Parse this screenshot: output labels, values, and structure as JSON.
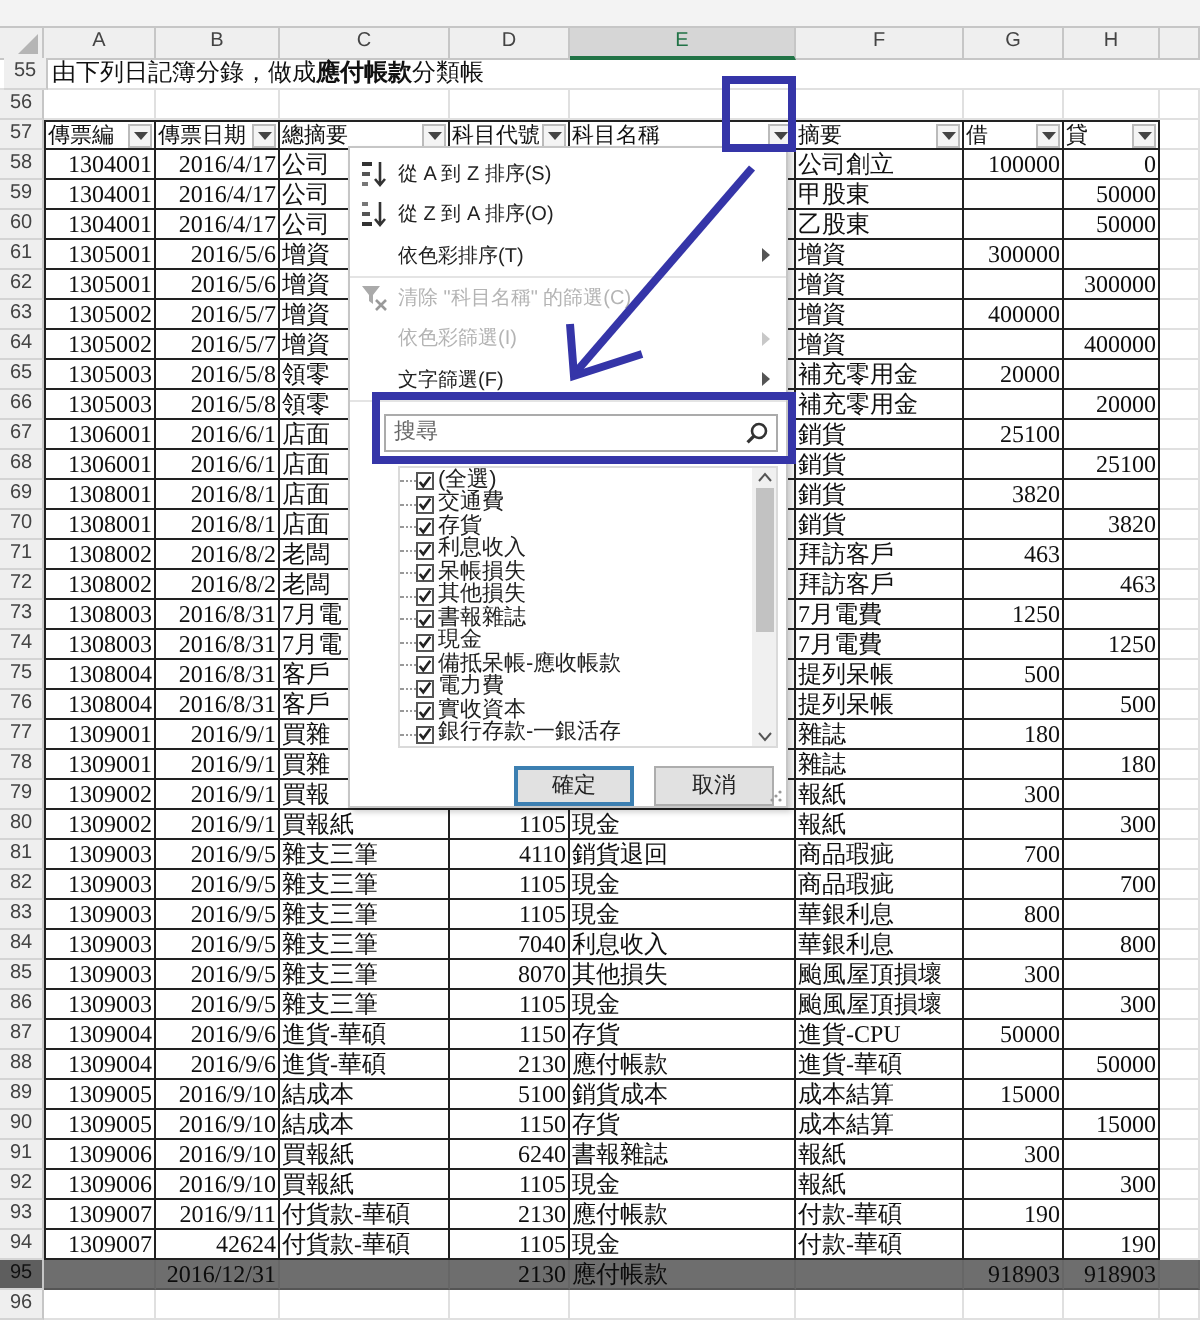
{
  "column_headers": [
    {
      "label": "A",
      "selected": false
    },
    {
      "label": "B",
      "selected": false
    },
    {
      "label": "C",
      "selected": false
    },
    {
      "label": "D",
      "selected": false
    },
    {
      "label": "E",
      "selected": true
    },
    {
      "label": "F",
      "selected": false
    },
    {
      "label": "G",
      "selected": false
    },
    {
      "label": "H",
      "selected": false
    }
  ],
  "rows": [
    {
      "number": "55",
      "kind": "title",
      "text": "由下列日記簿分錄，做成**應付帳款**分類帳"
    },
    {
      "number": "56",
      "kind": "blank"
    },
    {
      "number": "57",
      "kind": "header",
      "cells": [
        "傳票編",
        "傳票日期",
        "總摘要",
        "科目代號",
        "科目名稱",
        "摘要",
        "借",
        "貸"
      ]
    },
    {
      "number": "58",
      "kind": "data",
      "cells": [
        "1304001",
        "2016/4/17",
        "公司",
        null,
        null,
        "公司創立",
        "100000",
        "0"
      ]
    },
    {
      "number": "59",
      "kind": "data",
      "cells": [
        "1304001",
        "2016/4/17",
        "公司",
        null,
        null,
        "甲股東",
        null,
        "50000"
      ]
    },
    {
      "number": "60",
      "kind": "data",
      "cells": [
        "1304001",
        "2016/4/17",
        "公司",
        null,
        null,
        "乙股東",
        null,
        "50000"
      ]
    },
    {
      "number": "61",
      "kind": "data",
      "cells": [
        "1305001",
        "2016/5/6",
        "增資",
        null,
        null,
        "增資",
        "300000",
        null
      ]
    },
    {
      "number": "62",
      "kind": "data",
      "cells": [
        "1305001",
        "2016/5/6",
        "增資",
        null,
        null,
        "增資",
        null,
        "300000"
      ]
    },
    {
      "number": "63",
      "kind": "data",
      "cells": [
        "1305002",
        "2016/5/7",
        "增資",
        null,
        null,
        "增資",
        "400000",
        null
      ]
    },
    {
      "number": "64",
      "kind": "data",
      "cells": [
        "1305002",
        "2016/5/7",
        "增資",
        null,
        null,
        "增資",
        null,
        "400000"
      ]
    },
    {
      "number": "65",
      "kind": "data",
      "cells": [
        "1305003",
        "2016/5/8",
        "領零",
        null,
        null,
        "補充零用金",
        "20000",
        null
      ]
    },
    {
      "number": "66",
      "kind": "data",
      "cells": [
        "1305003",
        "2016/5/8",
        "領零",
        null,
        null,
        "補充零用金",
        null,
        "20000"
      ]
    },
    {
      "number": "67",
      "kind": "data",
      "cells": [
        "1306001",
        "2016/6/1",
        "店面",
        null,
        null,
        "銷貨",
        "25100",
        null
      ]
    },
    {
      "number": "68",
      "kind": "data",
      "cells": [
        "1306001",
        "2016/6/1",
        "店面",
        null,
        null,
        "銷貨",
        null,
        "25100"
      ]
    },
    {
      "number": "69",
      "kind": "data",
      "cells": [
        "1308001",
        "2016/8/1",
        "店面",
        null,
        null,
        "銷貨",
        "3820",
        null
      ]
    },
    {
      "number": "70",
      "kind": "data",
      "cells": [
        "1308001",
        "2016/8/1",
        "店面",
        null,
        null,
        "銷貨",
        null,
        "3820"
      ]
    },
    {
      "number": "71",
      "kind": "data",
      "cells": [
        "1308002",
        "2016/8/2",
        "老闆",
        null,
        null,
        "拜訪客戶",
        "463",
        null
      ]
    },
    {
      "number": "72",
      "kind": "data",
      "cells": [
        "1308002",
        "2016/8/2",
        "老闆",
        null,
        null,
        "拜訪客戶",
        null,
        "463"
      ]
    },
    {
      "number": "73",
      "kind": "data",
      "cells": [
        "1308003",
        "2016/8/31",
        "7月電",
        null,
        null,
        "7月電費",
        "1250",
        null
      ]
    },
    {
      "number": "74",
      "kind": "data",
      "cells": [
        "1308003",
        "2016/8/31",
        "7月電",
        null,
        null,
        "7月電費",
        null,
        "1250"
      ]
    },
    {
      "number": "75",
      "kind": "data",
      "cells": [
        "1308004",
        "2016/8/31",
        "客戶",
        null,
        null,
        "提列呆帳",
        "500",
        null
      ]
    },
    {
      "number": "76",
      "kind": "data",
      "cells": [
        "1308004",
        "2016/8/31",
        "客戶",
        null,
        null,
        "提列呆帳",
        null,
        "500"
      ]
    },
    {
      "number": "77",
      "kind": "data",
      "cells": [
        "1309001",
        "2016/9/1",
        "買雜",
        null,
        null,
        "雜誌",
        "180",
        null
      ]
    },
    {
      "number": "78",
      "kind": "data",
      "cells": [
        "1309001",
        "2016/9/1",
        "買雜",
        null,
        null,
        "雜誌",
        null,
        "180"
      ]
    },
    {
      "number": "79",
      "kind": "data",
      "cells": [
        "1309002",
        "2016/9/1",
        "買報",
        null,
        null,
        "報紙",
        "300",
        null
      ]
    },
    {
      "number": "80",
      "kind": "data",
      "cells": [
        "1309002",
        "2016/9/1",
        "買報紙",
        "1105",
        "現金",
        "報紙",
        null,
        "300"
      ]
    },
    {
      "number": "81",
      "kind": "data",
      "cells": [
        "1309003",
        "2016/9/5",
        "雜支三筆",
        "4110",
        "銷貨退回",
        "商品瑕疵",
        "700",
        null
      ]
    },
    {
      "number": "82",
      "kind": "data",
      "cells": [
        "1309003",
        "2016/9/5",
        "雜支三筆",
        "1105",
        "現金",
        "商品瑕疵",
        null,
        "700"
      ]
    },
    {
      "number": "83",
      "kind": "data",
      "cells": [
        "1309003",
        "2016/9/5",
        "雜支三筆",
        "1105",
        "現金",
        "華銀利息",
        "800",
        null
      ]
    },
    {
      "number": "84",
      "kind": "data",
      "cells": [
        "1309003",
        "2016/9/5",
        "雜支三筆",
        "7040",
        "利息收入",
        "華銀利息",
        null,
        "800"
      ]
    },
    {
      "number": "85",
      "kind": "data",
      "cells": [
        "1309003",
        "2016/9/5",
        "雜支三筆",
        "8070",
        "其他損失",
        "颱風屋頂損壞",
        "300",
        null
      ]
    },
    {
      "number": "86",
      "kind": "data",
      "cells": [
        "1309003",
        "2016/9/5",
        "雜支三筆",
        "1105",
        "現金",
        "颱風屋頂損壞",
        null,
        "300"
      ]
    },
    {
      "number": "87",
      "kind": "data",
      "cells": [
        "1309004",
        "2016/9/6",
        "進貨-華碩",
        "1150",
        "存貨",
        "進貨-CPU",
        "50000",
        null
      ]
    },
    {
      "number": "88",
      "kind": "data",
      "cells": [
        "1309004",
        "2016/9/6",
        "進貨-華碩",
        "2130",
        "應付帳款",
        "進貨-華碩",
        null,
        "50000"
      ]
    },
    {
      "number": "89",
      "kind": "data",
      "cells": [
        "1309005",
        "2016/9/10",
        "結成本",
        "5100",
        "銷貨成本",
        "成本結算",
        "15000",
        null
      ]
    },
    {
      "number": "90",
      "kind": "data",
      "cells": [
        "1309005",
        "2016/9/10",
        "結成本",
        "1150",
        "存貨",
        "成本結算",
        null,
        "15000"
      ]
    },
    {
      "number": "91",
      "kind": "data",
      "cells": [
        "1309006",
        "2016/9/10",
        "買報紙",
        "6240",
        "書報雜誌",
        "報紙",
        "300",
        null
      ]
    },
    {
      "number": "92",
      "kind": "data",
      "cells": [
        "1309006",
        "2016/9/10",
        "買報紙",
        "1105",
        "現金",
        "報紙",
        null,
        "300"
      ]
    },
    {
      "number": "93",
      "kind": "data",
      "cells": [
        "1309007",
        "2016/9/11",
        "付貨款-華碩",
        "2130",
        "應付帳款",
        "付款-華碩",
        "190",
        null
      ]
    },
    {
      "number": "94",
      "kind": "data",
      "cells": [
        "1309007",
        "42624",
        "付貨款-華碩",
        "1105",
        "現金",
        "付款-華碩",
        null,
        "190"
      ]
    },
    {
      "number": "95",
      "kind": "dark",
      "cells": [
        null,
        "2016/12/31",
        null,
        "2130",
        "應付帳款",
        null,
        "918903",
        "918903"
      ]
    },
    {
      "number": "96",
      "kind": "blank"
    }
  ],
  "filter_menu": {
    "items": [
      {
        "label": "從 A 到 Z 排序(S)",
        "kind": "sort-asc",
        "disabled": false,
        "submenu": false
      },
      {
        "label": "從 Z 到 A 排序(O)",
        "kind": "sort-desc",
        "disabled": false,
        "submenu": false
      },
      {
        "label": "依色彩排序(T)",
        "kind": "plain",
        "disabled": false,
        "submenu": true
      },
      {
        "label": "清除 \"科目名稱\" 的篩選(C)",
        "kind": "clear-filter",
        "disabled": true,
        "submenu": false
      },
      {
        "label": "依色彩篩選(I)",
        "kind": "plain",
        "disabled": true,
        "submenu": true
      },
      {
        "label": "文字篩選(F)",
        "kind": "plain",
        "disabled": false,
        "submenu": true
      }
    ],
    "search": {
      "placeholder": "搜尋"
    },
    "values": [
      {
        "label": "(全選)",
        "checked": true
      },
      {
        "label": "交通費",
        "checked": true
      },
      {
        "label": "存貨",
        "checked": true
      },
      {
        "label": "利息收入",
        "checked": true
      },
      {
        "label": "呆帳損失",
        "checked": true
      },
      {
        "label": "其他損失",
        "checked": true
      },
      {
        "label": "書報雜誌",
        "checked": true
      },
      {
        "label": "現金",
        "checked": true
      },
      {
        "label": "備抵呆帳-應收帳款",
        "checked": true
      },
      {
        "label": "電力費",
        "checked": true
      },
      {
        "label": "實收資本",
        "checked": true
      },
      {
        "label": "銀行存款-一銀活存",
        "checked": true
      }
    ],
    "buttons": [
      {
        "label": "確定",
        "selected": true
      },
      {
        "label": "取消",
        "selected": false
      }
    ]
  }
}
